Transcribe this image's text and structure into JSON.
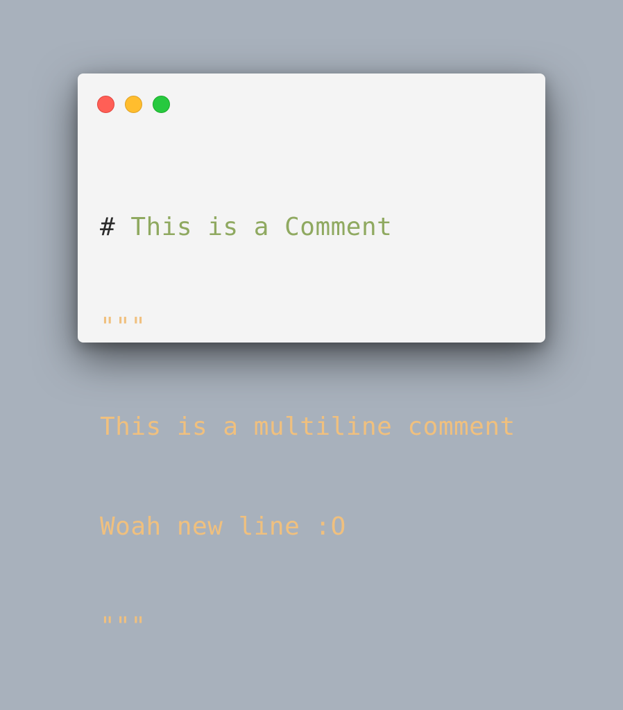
{
  "window": {
    "controls": [
      {
        "name": "close",
        "color": "#ff5f56"
      },
      {
        "name": "minimize",
        "color": "#ffbd2e"
      },
      {
        "name": "maximize",
        "color": "#27c93f"
      }
    ]
  },
  "code": {
    "comment_marker": "#",
    "comment_text": " This is a Comment",
    "docstring_open": "\"\"\"",
    "docstring_line1": "This is a multiline comment",
    "docstring_line2": "Woah new line :O",
    "docstring_close": "\"\"\""
  },
  "colors": {
    "background": "#a8b1bc",
    "window": "#f4f4f4",
    "comment": "#8fa960",
    "docstring": "#f0c07e",
    "text": "#2b2b2b"
  }
}
